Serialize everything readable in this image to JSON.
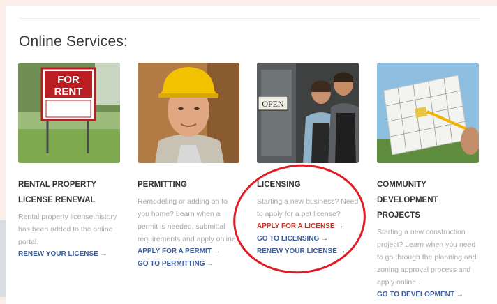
{
  "section_title": "Online Services:",
  "cards": [
    {
      "title": "RENTAL PROPERTY LICENSE RENEWAL",
      "desc": "Rental property license history has been added to the online portal.",
      "links": [
        "RENEW YOUR LICENSE →"
      ],
      "image_text": [
        "FOR",
        "RENT"
      ]
    },
    {
      "title": "PERMITTING",
      "desc": "Remodeling or adding on to you home? Learn when a permit is needed, submittal requirements and apply online.",
      "links": [
        "APPLY FOR A PERMIT →",
        "GO TO PERMITTING →"
      ]
    },
    {
      "title": "LICENSING",
      "desc": "Starting a new business? Need to apply for a pet license?",
      "links": [
        "APPLY FOR A LICENSE →",
        "GO TO LICENSING →",
        "RENEW YOUR LICENSE →"
      ],
      "image_text": [
        "OPEN"
      ]
    },
    {
      "title": "COMMUNITY DEVELOPMENT PROJECTS",
      "desc": "Starting a new construction project? Learn when you need to go through the planning and zoning approval process and apply online..",
      "links": [
        "GO TO DEVELOPMENT →"
      ]
    }
  ],
  "colors": {
    "link": "#3e5f9e",
    "link_highlight": "#c0392b",
    "annotation_circle": "#e01b24"
  }
}
